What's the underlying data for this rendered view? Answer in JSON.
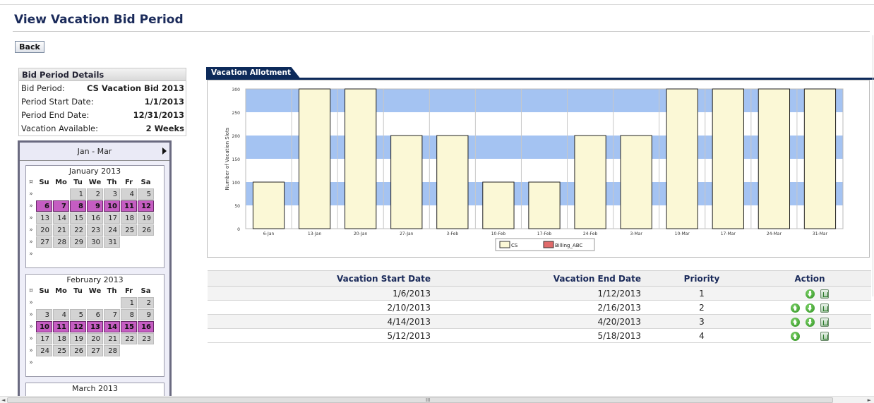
{
  "header": {
    "title": "View Vacation Bid Period",
    "back_label": "Back"
  },
  "details": {
    "heading": "Bid Period Details",
    "rows": [
      {
        "label": "Bid Period:",
        "value": "CS Vacation Bid 2013"
      },
      {
        "label": "Period Start Date:",
        "value": "1/1/2013"
      },
      {
        "label": "Period End Date:",
        "value": "12/31/2013"
      },
      {
        "label": "Vacation Available:",
        "value": "2 Weeks"
      }
    ]
  },
  "calendar": {
    "range_label": "Jan - Mar",
    "weekdays": [
      "Su",
      "Mo",
      "Tu",
      "We",
      "Th",
      "Fr",
      "Sa"
    ],
    "week_marker": "»",
    "corner_marker": "¤",
    "months": [
      {
        "title": "January 2013",
        "weeks": [
          [
            null,
            null,
            1,
            2,
            3,
            4,
            5
          ],
          [
            6,
            7,
            8,
            9,
            10,
            11,
            12
          ],
          [
            13,
            14,
            15,
            16,
            17,
            18,
            19
          ],
          [
            20,
            21,
            22,
            23,
            24,
            25,
            26
          ],
          [
            27,
            28,
            29,
            30,
            31,
            null,
            null
          ],
          [
            null,
            null,
            null,
            null,
            null,
            null,
            null
          ]
        ],
        "selected": [
          6,
          7,
          8,
          9,
          10,
          11,
          12
        ]
      },
      {
        "title": "February 2013",
        "weeks": [
          [
            null,
            null,
            null,
            null,
            null,
            1,
            2
          ],
          [
            3,
            4,
            5,
            6,
            7,
            8,
            9
          ],
          [
            10,
            11,
            12,
            13,
            14,
            15,
            16
          ],
          [
            17,
            18,
            19,
            20,
            21,
            22,
            23
          ],
          [
            24,
            25,
            26,
            27,
            28,
            null,
            null
          ],
          [
            null,
            null,
            null,
            null,
            null,
            null,
            null
          ]
        ],
        "selected": [
          10,
          11,
          12,
          13,
          14,
          15,
          16
        ]
      },
      {
        "title": "March 2013",
        "weeks": [],
        "selected": []
      }
    ]
  },
  "tab_label": "Vacation Allotment",
  "chart_data": {
    "type": "bar",
    "title": "",
    "ylabel": "Number of Vacation Slots",
    "xlabel": "",
    "ylim": [
      0,
      300
    ],
    "yticks": [
      0,
      50,
      100,
      150,
      200,
      250,
      300
    ],
    "categories": [
      "6-Jan",
      "13-Jan",
      "20-Jan",
      "27-Jan",
      "3-Feb",
      "10-Feb",
      "17-Feb",
      "24-Feb",
      "3-Mar",
      "10-Mar",
      "17-Mar",
      "24-Mar",
      "31-Mar"
    ],
    "series": [
      {
        "name": "CS",
        "color": "#fbf8d6",
        "values": [
          100,
          300,
          300,
          200,
          200,
          100,
          100,
          200,
          200,
          300,
          300,
          300,
          300
        ]
      },
      {
        "name": "Billing_ABC",
        "color": "#e06a6a",
        "values": [
          0,
          0,
          0,
          0,
          0,
          0,
          0,
          0,
          0,
          0,
          0,
          0,
          0
        ]
      }
    ],
    "band_color": "#a4c3f2",
    "legend": "bottom"
  },
  "table": {
    "headers": {
      "start": "Vacation Start Date",
      "end": "Vacation End Date",
      "priority": "Priority",
      "action": "Action"
    },
    "rows": [
      {
        "start": "1/6/2013",
        "end": "1/12/2013",
        "priority": "1",
        "actions": [
          "down-icon",
          "trash-icon"
        ]
      },
      {
        "start": "2/10/2013",
        "end": "2/16/2013",
        "priority": "2",
        "actions": [
          "up-icon",
          "down-icon",
          "trash-icon"
        ]
      },
      {
        "start": "4/14/2013",
        "end": "4/20/2013",
        "priority": "3",
        "actions": [
          "up-icon",
          "down-icon",
          "trash-icon"
        ]
      },
      {
        "start": "5/12/2013",
        "end": "5/18/2013",
        "priority": "4",
        "actions": [
          "up-icon",
          "trash-icon"
        ]
      }
    ]
  },
  "scrollbar": {
    "grip": "III",
    "left_arrow": "◄",
    "right_arrow": "►"
  }
}
